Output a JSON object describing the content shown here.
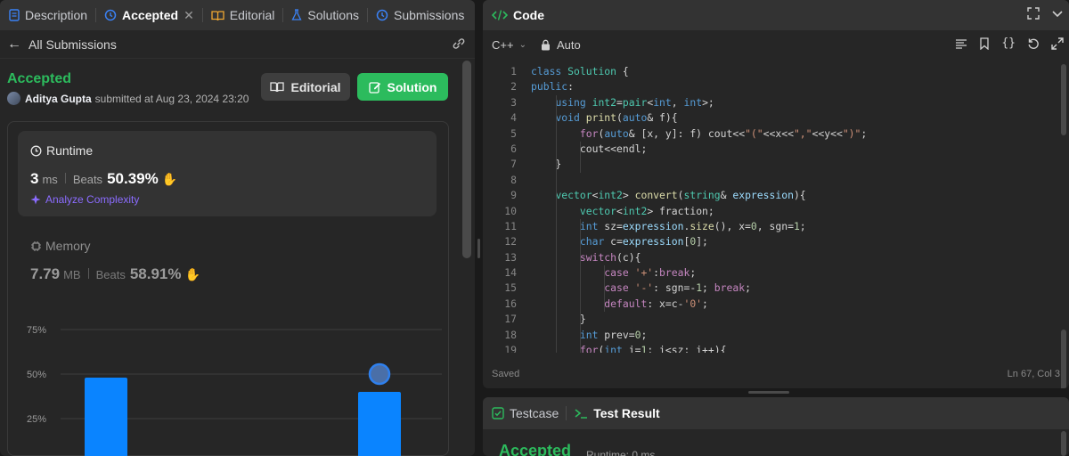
{
  "left_tabs": [
    {
      "label": "Description"
    },
    {
      "label": "Accepted"
    },
    {
      "label": "Editorial"
    },
    {
      "label": "Solutions"
    },
    {
      "label": "Submissions"
    }
  ],
  "subheader": {
    "back_label": "All Submissions"
  },
  "submission": {
    "status": "Accepted",
    "author": "Aditya Gupta",
    "submitted_text": "submitted at Aug 23, 2024 23:20"
  },
  "buttons": {
    "editorial": "Editorial",
    "solution": "Solution"
  },
  "runtime": {
    "title": "Runtime",
    "value": "3",
    "unit": "ms",
    "beats_label": "Beats",
    "beats_pct": "50.39%",
    "analyze": "Analyze Complexity"
  },
  "memory": {
    "title": "Memory",
    "value": "7.79",
    "unit": "MB",
    "beats_label": "Beats",
    "beats_pct": "58.91%"
  },
  "chart_data": {
    "type": "bar",
    "y_ticks": [
      "75%",
      "50%",
      "25%"
    ],
    "ylim": [
      0,
      75
    ],
    "bars": [
      {
        "value": 48,
        "highlight": false
      },
      {
        "value": 40,
        "highlight": true
      }
    ],
    "bar_color": "#0a84ff",
    "grid": true
  },
  "code_panel": {
    "title": "Code",
    "language": "C++",
    "mode": "Auto",
    "status": "Saved",
    "cursor": "Ln 67, Col 3"
  },
  "code_lines": [
    {
      "n": "1",
      "html": "<span class=\"kw\">class</span> <span class=\"ty\">Solution</span> {"
    },
    {
      "n": "2",
      "html": "<span class=\"kw\">public</span>:"
    },
    {
      "n": "3",
      "html": "    <span class=\"kw\">using</span> <span class=\"ty\">int2</span>=<span class=\"ty\">pair</span>&lt;<span class=\"kw\">int</span>, <span class=\"kw\">int</span>&gt;;"
    },
    {
      "n": "4",
      "html": "    <span class=\"kw\">void</span> <span class=\"fn\">print</span>(<span class=\"kw\">auto</span>&amp; f){"
    },
    {
      "n": "5",
      "html": "        <span class=\"pk\">for</span>(<span class=\"kw\">auto</span>&amp; [x, y]: f) cout&lt;&lt;<span class=\"st\">\"(\"</span>&lt;&lt;x&lt;&lt;<span class=\"st\">\",\"</span>&lt;&lt;y&lt;&lt;<span class=\"st\">\")\"</span>;"
    },
    {
      "n": "6",
      "html": "        cout&lt;&lt;endl;"
    },
    {
      "n": "7",
      "html": "    }"
    },
    {
      "n": "8",
      "html": ""
    },
    {
      "n": "9",
      "html": "    <span class=\"ty\">vector</span>&lt;<span class=\"ty\">int2</span>&gt; <span class=\"fn\">convert</span>(<span class=\"ty\">string</span>&amp; <span class=\"va\">expression</span>){"
    },
    {
      "n": "10",
      "html": "        <span class=\"ty\">vector</span>&lt;<span class=\"ty\">int2</span>&gt; fraction;"
    },
    {
      "n": "11",
      "html": "        <span class=\"kw\">int</span> sz=<span class=\"va\">expression</span>.<span class=\"fn\">size</span>(), x=<span class=\"nu\">0</span>, sgn=<span class=\"nu\">1</span>;"
    },
    {
      "n": "12",
      "html": "        <span class=\"kw\">char</span> c=<span class=\"va\">expression</span>[<span class=\"nu\">0</span>];"
    },
    {
      "n": "13",
      "html": "        <span class=\"pk\">switch</span>(c){"
    },
    {
      "n": "14",
      "html": "            <span class=\"pk\">case</span> <span class=\"st\">'+'</span>:<span class=\"pk\">break</span>;"
    },
    {
      "n": "15",
      "html": "            <span class=\"pk\">case</span> <span class=\"st\">'-'</span>: sgn=-<span class=\"nu\">1</span>; <span class=\"pk\">break</span>;"
    },
    {
      "n": "16",
      "html": "            <span class=\"pk\">default</span>: x=c-<span class=\"st\">'0'</span>;"
    },
    {
      "n": "17",
      "html": "        }"
    },
    {
      "n": "18",
      "html": "        <span class=\"kw\">int</span> prev=<span class=\"nu\">0</span>;"
    },
    {
      "n": "19",
      "html": "        <span class=\"pk\">for</span>(<span class=\"kw\">int</span> i=<span class=\"nu\">1</span>; i&lt;sz; i++){"
    }
  ],
  "bottom_panel": {
    "tab_testcase": "Testcase",
    "tab_result": "Test Result",
    "status": "Accepted",
    "runtime": "Runtime: 0 ms"
  },
  "colors": {
    "accent_green": "#2cbb5d",
    "bar_blue": "#0a84ff",
    "purple": "#8b6cff"
  }
}
